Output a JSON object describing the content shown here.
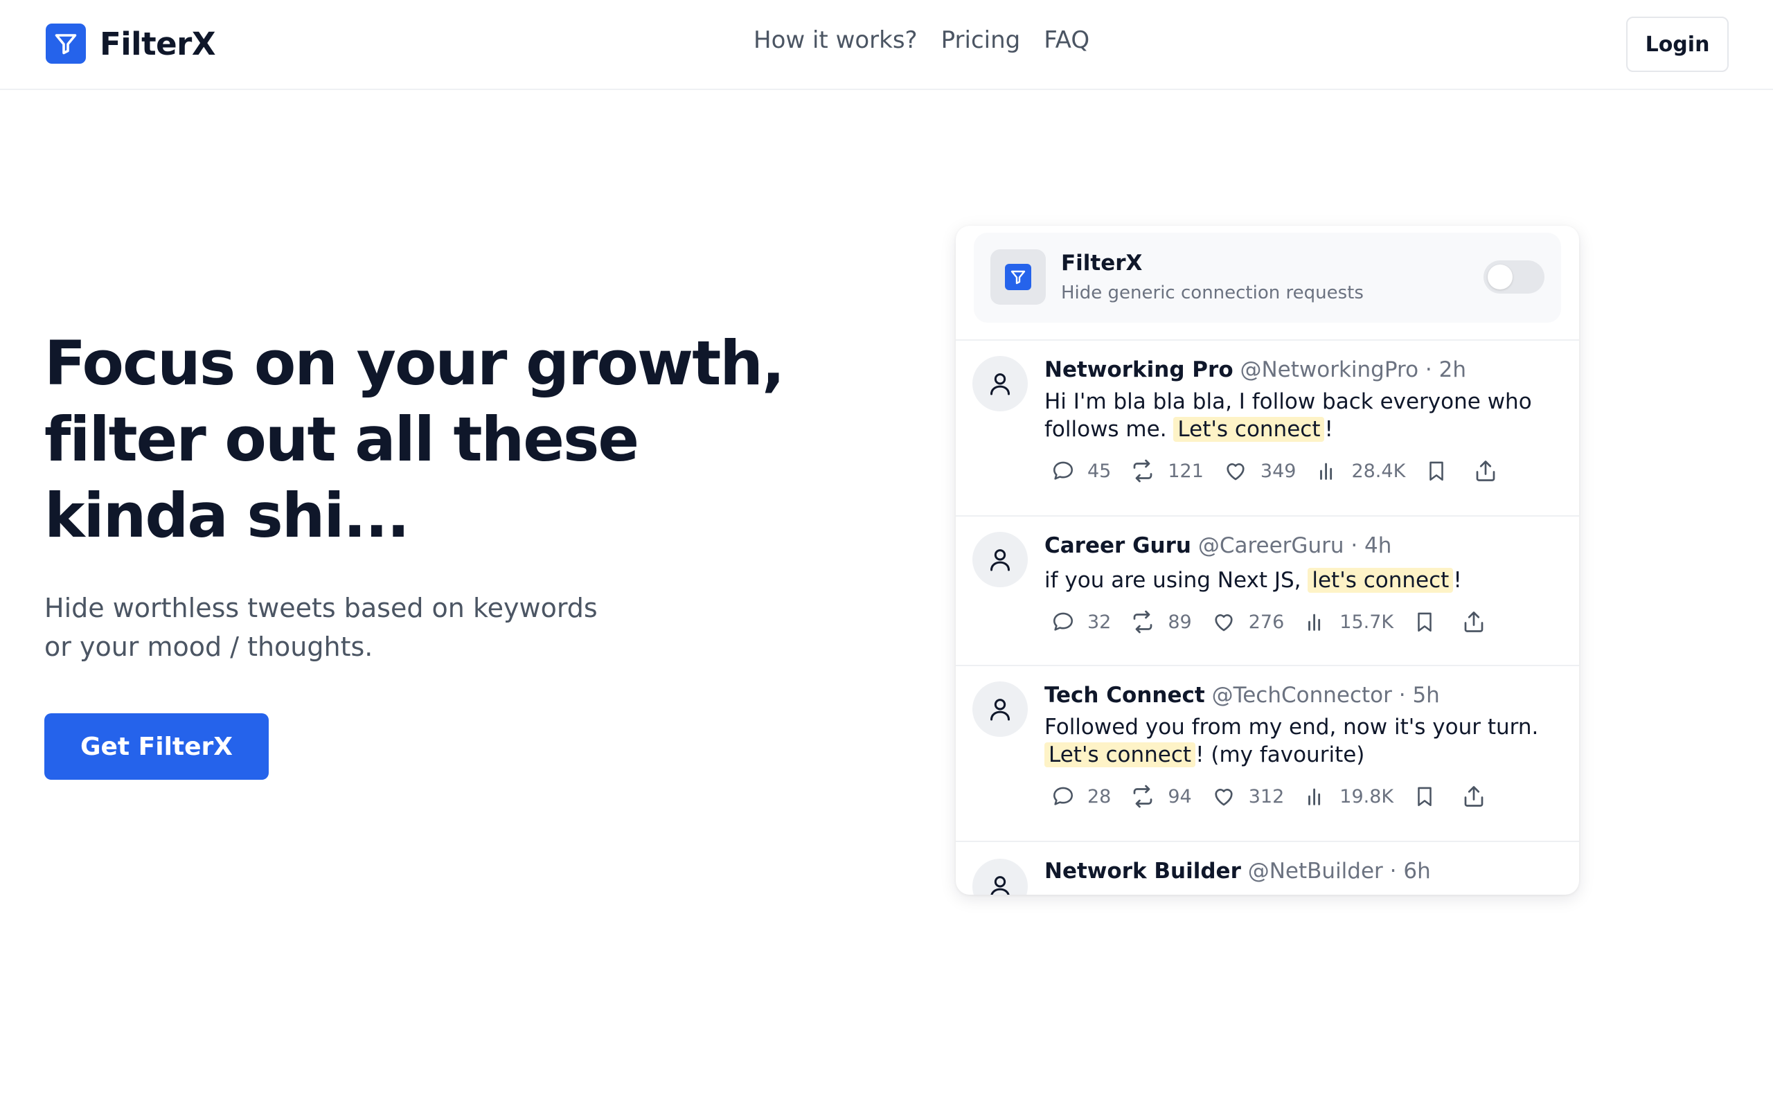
{
  "header": {
    "brand_name": "FilterX",
    "nav": [
      "How it works?",
      "Pricing",
      "FAQ"
    ],
    "login_label": "Login"
  },
  "hero": {
    "title_lines": [
      "Focus on your growth,",
      "filter out all these",
      "kinda shi..."
    ],
    "subtitle_lines": [
      "Hide worthless tweets based on keywords",
      "or your mood / thoughts."
    ],
    "cta_label": "Get FilterX"
  },
  "extension": {
    "title": "FilterX",
    "description": "Hide generic connection requests",
    "toggle_on": false
  },
  "tweets": [
    {
      "name": "Networking Pro",
      "handle": "@NetworkingPro · 2h",
      "text_before": "Hi I'm bla bla bla, I follow back everyone who follows me. ",
      "highlight": "Let's connect",
      "text_after": "!",
      "replies": "45",
      "retweets": "121",
      "likes": "349",
      "views": "28.4K"
    },
    {
      "name": "Career Guru",
      "handle": "@CareerGuru · 4h",
      "text_before": "if you are using Next JS, ",
      "highlight": "let's connect",
      "text_after": "!",
      "replies": "32",
      "retweets": "89",
      "likes": "276",
      "views": "15.7K"
    },
    {
      "name": "Tech Connect",
      "handle": "@TechConnector · 5h",
      "text_before": "Followed you from my end, now it's your turn. ",
      "highlight": "Let's connect",
      "text_after": "! (my favourite)",
      "replies": "28",
      "retweets": "94",
      "likes": "312",
      "views": "19.8K"
    },
    {
      "name": "Network Builder",
      "handle": "@NetBuilder · 6h"
    }
  ],
  "colors": {
    "accent": "#2563eb",
    "highlight": "#fef3c7",
    "text": "#0f172a",
    "muted": "#6b7280"
  },
  "icons": {
    "brand": "filter-icon",
    "avatar": "user-icon",
    "actions": [
      "reply-icon",
      "retweet-icon",
      "like-icon",
      "views-icon",
      "bookmark-icon",
      "share-icon"
    ]
  }
}
